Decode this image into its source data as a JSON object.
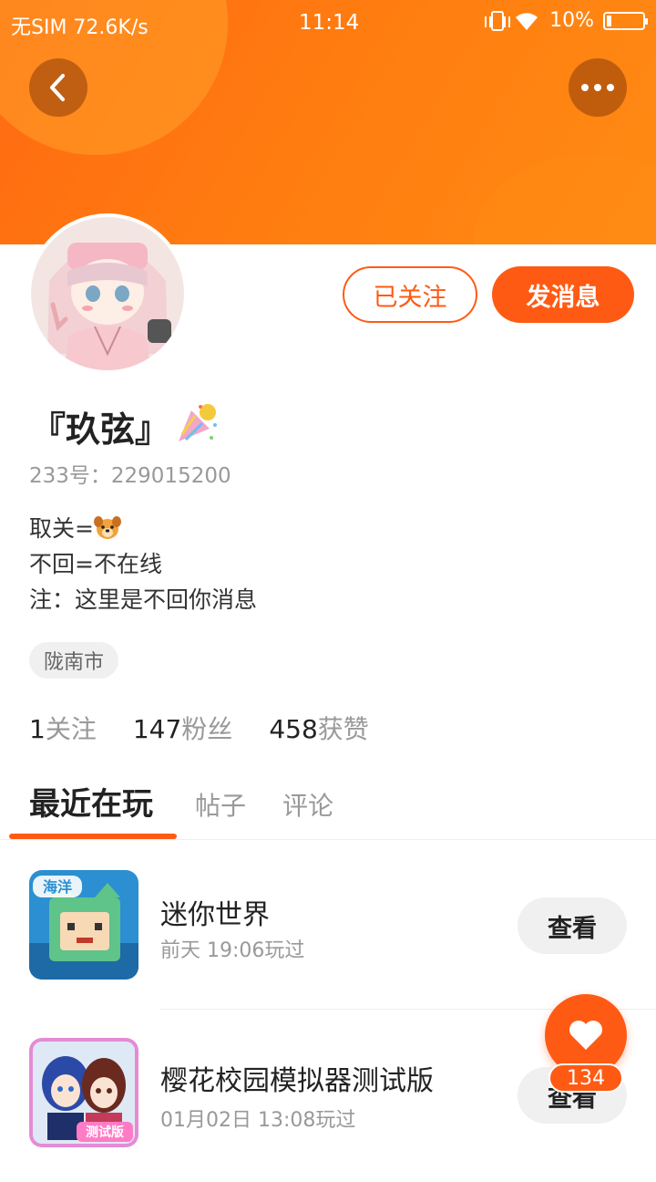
{
  "status_bar": {
    "carrier": "无SIM 72.6K/s",
    "time": "11:14",
    "battery_text": "10%"
  },
  "toolbar": {
    "back_icon": "chevron-left-icon",
    "more_icon": "ellipsis-icon"
  },
  "actions": {
    "followed_label": "已关注",
    "message_label": "发消息"
  },
  "profile": {
    "name": "『玖弦』",
    "id_text": "233号：229015200",
    "bio": {
      "line1": "取关=",
      "line2": "不回=不在线",
      "line3": "注：这里是不回你消息"
    },
    "location": "陇南市"
  },
  "stats": {
    "following_count": "1",
    "following_label": "关注",
    "followers_count": "147",
    "followers_label": "粉丝",
    "likes_count": "458",
    "likes_label": "获赞"
  },
  "tabs": {
    "recent": "最近在玩",
    "posts": "帖子",
    "comments": "评论"
  },
  "games": [
    {
      "name": "迷你世界",
      "time": "前天 19:06玩过",
      "button": "查看",
      "icon_text": "海洋"
    },
    {
      "name": "樱花校园模拟器测试版",
      "time": "01月02日 13:08玩过",
      "button": "查看",
      "icon_text": "测试版"
    }
  ],
  "like_widget": {
    "count": "134",
    "icon": "heart-icon"
  },
  "colors": {
    "accent": "#ff5a14",
    "header": "#ff7a10"
  }
}
